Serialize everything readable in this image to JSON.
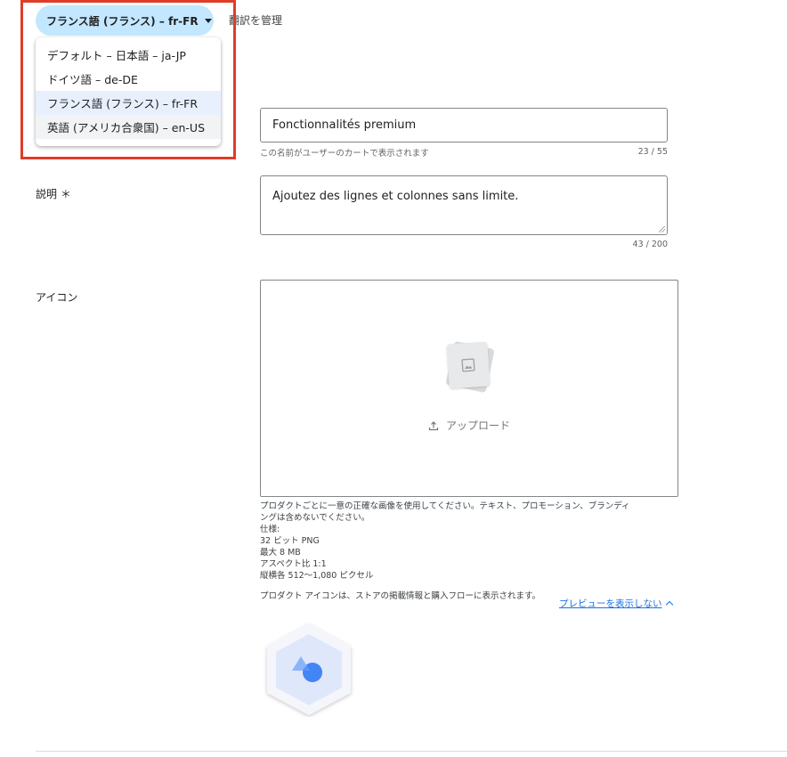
{
  "language": {
    "current_label": "フランス語 (フランス) – fr-FR",
    "manage_label": "翻訳を管理",
    "options": [
      {
        "label": "デフォルト – 日本語 – ja-JP"
      },
      {
        "label": "ドイツ語 – de-DE"
      },
      {
        "label": "フランス語 (フランス) – fr-FR"
      },
      {
        "label": "英語 (アメリカ合衆国) – en-US"
      }
    ]
  },
  "name_field": {
    "value": "Fonctionnalités premium",
    "helper": "この名前がユーザーのカートで表示されます",
    "counter": "23 / 55"
  },
  "description_field": {
    "label": "説明 ＊",
    "value": "Ajoutez des lignes et colonnes sans limite.",
    "counter": "43 / 200"
  },
  "icon_field": {
    "label": "アイコン",
    "upload_label": "アップロード",
    "guidelines": [
      "プロダクトごとに一意の正確な画像を使用してください。テキスト、プロモーション、ブランディ",
      "ングは含めないでください。",
      "仕様:",
      "32 ビット PNG",
      "最大 8 MB",
      "アスペクト比 1:1",
      "縦横各 512〜1,080 ピクセル"
    ],
    "preview_note": "プロダクト アイコンは、ストアの掲載情報と購入フローに表示されます。",
    "preview_toggle": "プレビューを表示しない"
  },
  "colors": {
    "chip_bg": "#c2e7ff",
    "highlight_border": "#e03c28",
    "link": "#1a73e8"
  }
}
